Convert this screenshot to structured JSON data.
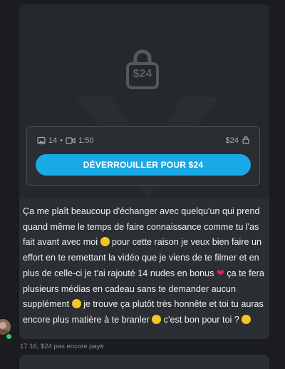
{
  "locked_media": {
    "price_overlay": "$24",
    "photo_count": "14",
    "separator": "•",
    "video_duration": "1:50",
    "price": "$24",
    "unlock_label": "DÉVERROUILLER POUR $24"
  },
  "message": {
    "segments": [
      "Ça me plaît beaucoup d'échanger avec quelqu'un qui prend quand même le temps de faire connaissance comme tu l'as fait avant avec moi ",
      " pour cette raison je veux bien faire un effort en te remettant la vidéo que je viens de te filmer et en plus de celle-ci je t'ai rajouté 14 nudes en bonus ",
      " ça te fera plusieurs médias en cadeau sans te demander aucun supplément ",
      " je trouve ça plutôt très honnête et toi tu auras encore plus matière à te branler ",
      " c'est bon pour toi ? "
    ],
    "emoji_names": [
      "grinning-sweat-emoji",
      "red-heart-emoji",
      "winking-emoji",
      "tongue-squint-emoji",
      "smiling-emoji"
    ]
  },
  "footer": {
    "timestamp": "17:16, $24 pas encore payé"
  },
  "colors": {
    "accent": "#19a9e5",
    "bubble_bg": "#2b2e33",
    "text": "#f1f2f3",
    "online": "#2ecc71",
    "heart": "#e0245e"
  }
}
